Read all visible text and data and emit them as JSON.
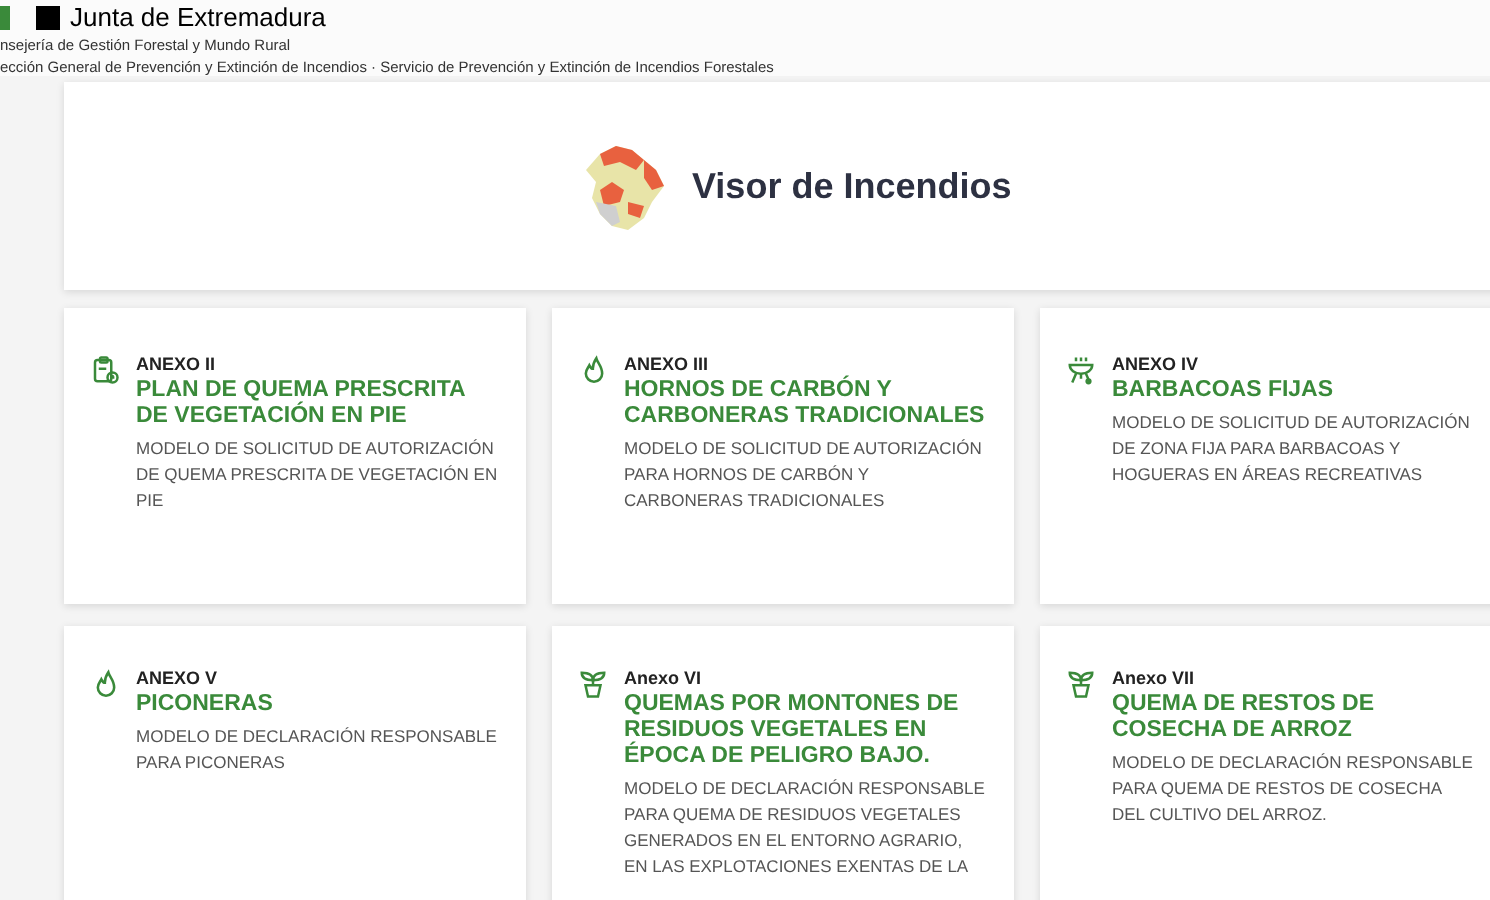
{
  "header": {
    "brand": "Junta de Extremadura",
    "line_1": "nsejería de Gestión Forestal y Mundo Rural",
    "line_2": "ección General de Prevención y Extinción de Incendios · Servicio de Prevención y Extinción de Incendios Forestales"
  },
  "banner": {
    "title": "Visor de Incendios"
  },
  "cards": [
    {
      "kind": "clipboard",
      "label": "ANEXO II",
      "title": "PLAN DE QUEMA PRESCRITA DE VEGETACIÓN EN PIE",
      "description": "MODELO DE SOLICITUD DE AUTORIZACIÓN DE QUEMA PRESCRITA DE VEGETACIÓN EN PIE"
    },
    {
      "kind": "flame",
      "label": "ANEXO III",
      "title": "HORNOS DE CARBÓN Y CARBONERAS TRADICIONALES",
      "description": "MODELO DE SOLICITUD DE AUTORIZACIÓN PARA HORNOS DE CARBÓN Y CARBONERAS TRADICIONALES"
    },
    {
      "kind": "grill",
      "label": "ANEXO IV",
      "title": "BARBACOAS FIJAS",
      "description": "MODELO DE SOLICITUD DE AUTORIZACIÓN DE ZONA FIJA PARA BARBACOAS Y HOGUERAS EN ÁREAS RECREATIVAS"
    },
    {
      "kind": "flame",
      "label": "ANEXO V",
      "title": "PICONERAS",
      "description": "MODELO DE DECLARACIÓN RESPONSABLE PARA PICONERAS"
    },
    {
      "kind": "sprout",
      "label": "Anexo VI",
      "title": "QUEMAS POR MONTONES DE RESIDUOS VEGETALES EN ÉPOCA DE PELIGRO BAJO.",
      "description": "MODELO DE DECLARACIÓN RESPONSABLE PARA QUEMA DE RESIDUOS VEGETALES GENERADOS EN EL ENTORNO AGRARIO, EN LAS EXPLOTACIONES EXENTAS DE LA"
    },
    {
      "kind": "sprout",
      "label": "Anexo VII",
      "title": "QUEMA DE RESTOS DE COSECHA DE ARROZ",
      "description": "MODELO DE DECLARACIÓN RESPONSABLE PARA QUEMA DE RESTOS DE COSECHA DEL CULTIVO DEL ARROZ."
    }
  ]
}
